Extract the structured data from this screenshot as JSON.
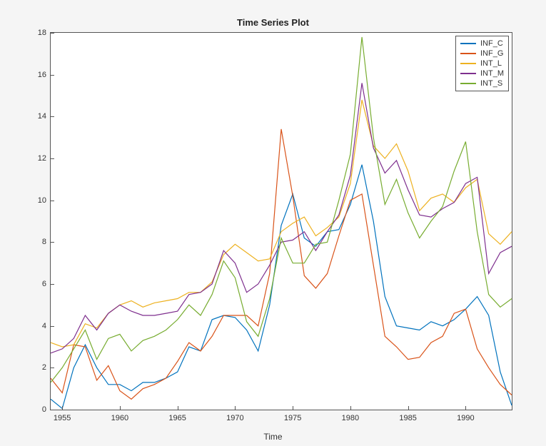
{
  "chart_data": {
    "type": "line",
    "title": "Time Series Plot",
    "xlabel": "Time",
    "ylabel": "",
    "xlim": [
      1954,
      1994
    ],
    "ylim": [
      0,
      18
    ],
    "xticks": [
      1955,
      1960,
      1965,
      1970,
      1975,
      1980,
      1985,
      1990
    ],
    "yticks": [
      0,
      2,
      4,
      6,
      8,
      10,
      12,
      14,
      16,
      18
    ],
    "x": [
      1954,
      1955,
      1956,
      1957,
      1958,
      1959,
      1960,
      1961,
      1962,
      1963,
      1964,
      1965,
      1966,
      1967,
      1968,
      1969,
      1970,
      1971,
      1972,
      1973,
      1974,
      1975,
      1976,
      1977,
      1978,
      1979,
      1980,
      1981,
      1982,
      1983,
      1984,
      1985,
      1986,
      1987,
      1988,
      1989,
      1990,
      1991,
      1992,
      1993,
      1994
    ],
    "series": [
      {
        "name": "INF_C",
        "color": "#0072BD",
        "values": [
          0.5,
          0.05,
          2.0,
          3.1,
          2.0,
          1.2,
          1.2,
          0.9,
          1.3,
          1.3,
          1.5,
          1.8,
          3.0,
          2.8,
          4.3,
          4.5,
          4.4,
          3.8,
          2.8,
          5.0,
          8.8,
          10.3,
          8.2,
          7.8,
          8.5,
          8.6,
          9.8,
          11.7,
          9.0,
          5.4,
          4.0,
          3.9,
          3.8,
          4.2,
          4.0,
          4.3,
          4.8,
          5.4,
          4.5,
          1.8,
          0.2
        ]
      },
      {
        "name": "INF_G",
        "color": "#D95319",
        "values": [
          1.5,
          0.8,
          3.1,
          3.0,
          1.4,
          2.1,
          0.9,
          0.5,
          1.0,
          1.2,
          1.5,
          2.3,
          3.2,
          2.8,
          3.5,
          4.5,
          4.5,
          4.5,
          4.0,
          6.5,
          13.4,
          10.2,
          6.4,
          5.8,
          6.5,
          8.3,
          10.0,
          10.3,
          6.9,
          3.5,
          3.0,
          2.4,
          2.5,
          3.2,
          3.5,
          4.6,
          4.8,
          2.9,
          2.0,
          1.2,
          0.7
        ]
      },
      {
        "name": "INT_L",
        "color": "#EDB120",
        "values": [
          3.2,
          3.0,
          3.1,
          4.1,
          3.9,
          4.6,
          5.0,
          5.2,
          4.9,
          5.1,
          5.2,
          5.3,
          5.6,
          5.6,
          6.1,
          7.4,
          7.9,
          7.5,
          7.1,
          7.2,
          8.5,
          8.9,
          9.2,
          8.3,
          8.7,
          9.2,
          10.8,
          14.8,
          12.6,
          12.0,
          12.7,
          11.4,
          9.5,
          10.1,
          10.3,
          9.9,
          10.6,
          11.0,
          8.4,
          7.9,
          8.5
        ]
      },
      {
        "name": "INT_M",
        "color": "#7E2F8E",
        "values": [
          2.7,
          2.9,
          3.4,
          4.5,
          3.8,
          4.6,
          5.0,
          4.7,
          4.5,
          4.5,
          4.6,
          4.7,
          5.5,
          5.6,
          6.0,
          7.6,
          7.0,
          5.6,
          6.0,
          6.9,
          8.0,
          8.1,
          8.5,
          7.6,
          8.5,
          9.3,
          11.2,
          15.6,
          12.5,
          11.3,
          11.9,
          10.5,
          9.3,
          9.2,
          9.6,
          9.9,
          10.8,
          11.1,
          6.5,
          7.5,
          7.8
        ]
      },
      {
        "name": "INT_S",
        "color": "#77AC30",
        "values": [
          1.3,
          2.0,
          2.9,
          3.8,
          2.4,
          3.4,
          3.6,
          2.8,
          3.3,
          3.5,
          3.8,
          4.3,
          5.0,
          4.5,
          5.5,
          7.1,
          6.3,
          4.2,
          3.5,
          5.3,
          8.2,
          7.0,
          7.0,
          7.9,
          8.0,
          10.0,
          12.2,
          17.8,
          13.0,
          9.8,
          11.0,
          9.4,
          8.2,
          9.0,
          9.7,
          11.4,
          12.8,
          8.5,
          5.5,
          4.9,
          5.3
        ]
      }
    ]
  }
}
